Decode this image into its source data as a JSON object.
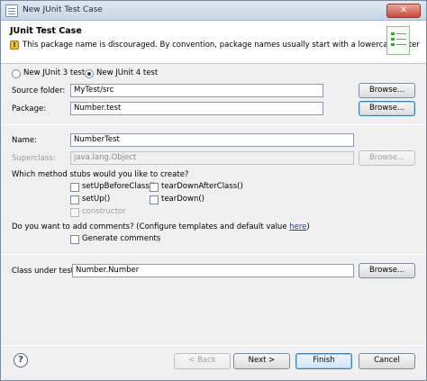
{
  "window": {
    "title": "New JUnit Test Case",
    "close_glyph": "✕"
  },
  "banner": {
    "title": "JUnit Test Case",
    "warning_glyph": "!",
    "message": "This package name is discouraged. By convention, package names usually start with a lowercase letter"
  },
  "version": {
    "junit3_label": "New JUnit 3 test",
    "junit4_label": "New JUnit 4 test",
    "selected": "junit4"
  },
  "source_folder": {
    "label": "Source folder:",
    "value": "MyTest/src",
    "browse": "Browse..."
  },
  "package": {
    "label": "Package:",
    "value": "Number.test",
    "browse": "Browse..."
  },
  "name": {
    "label": "Name:",
    "value": "NumberTest"
  },
  "superclass": {
    "label": "Superclass:",
    "value": "java.lang.Object",
    "browse": "Browse..."
  },
  "stubs": {
    "question": "Which method stubs would you like to create?",
    "setup_before_class": "setUpBeforeClass()",
    "teardown_after_class": "tearDownAfterClass()",
    "setup": "setUp()",
    "teardown": "tearDown()",
    "constructor": "constructor"
  },
  "comments": {
    "question": "Do you want to add comments? (Configure templates and default value ",
    "link": "here",
    "close_paren": ")",
    "generate": "Generate comments"
  },
  "class_under_test": {
    "label": "Class under test:",
    "value": "Number.Number",
    "browse": "Browse..."
  },
  "footer": {
    "help_glyph": "?",
    "back": "< Back",
    "next": "Next >",
    "finish": "Finish",
    "cancel": "Cancel"
  }
}
